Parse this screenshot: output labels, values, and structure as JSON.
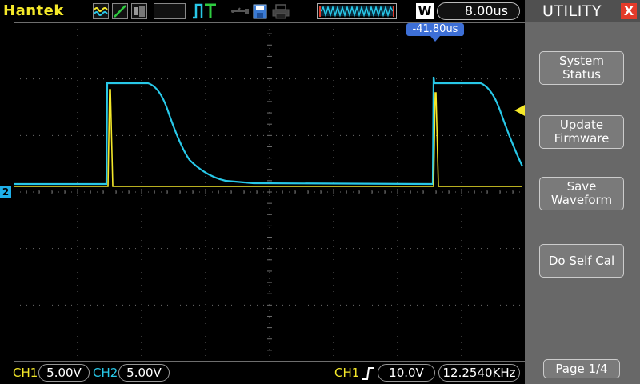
{
  "header": {
    "brand": "Hantek",
    "mode_badge": "W",
    "timebase": "8.00us",
    "trigger_position": "-41.80us"
  },
  "channels": {
    "ch1": {
      "label": "CH1",
      "scale": "5.00V",
      "color": "#f4e82a"
    },
    "ch2": {
      "label": "CH2",
      "scale": "5.00V",
      "color": "#28c8e8"
    },
    "ch2_marker": "2"
  },
  "trigger": {
    "source": "CH1",
    "level": "10.0V",
    "frequency": "12.2540KHz"
  },
  "panel": {
    "title": "UTILITY",
    "close": "X",
    "buttons": {
      "system_status": "System\nStatus",
      "update_firmware": "Update\nFirmware",
      "save_waveform": "Save\nWaveform",
      "self_cal": "Do Self Cal"
    },
    "page": "Page 1/4"
  },
  "icons": [
    "wave-icon",
    "ramp-icon",
    "gray-icon",
    "trigger-t-icon",
    "usb-icon",
    "disk-icon",
    "print-icon"
  ],
  "colors": {
    "grid": "#6e6e6e",
    "panel": "#686868",
    "trigger_marker": "#3d6fd6",
    "close": "#e43b2a"
  }
}
